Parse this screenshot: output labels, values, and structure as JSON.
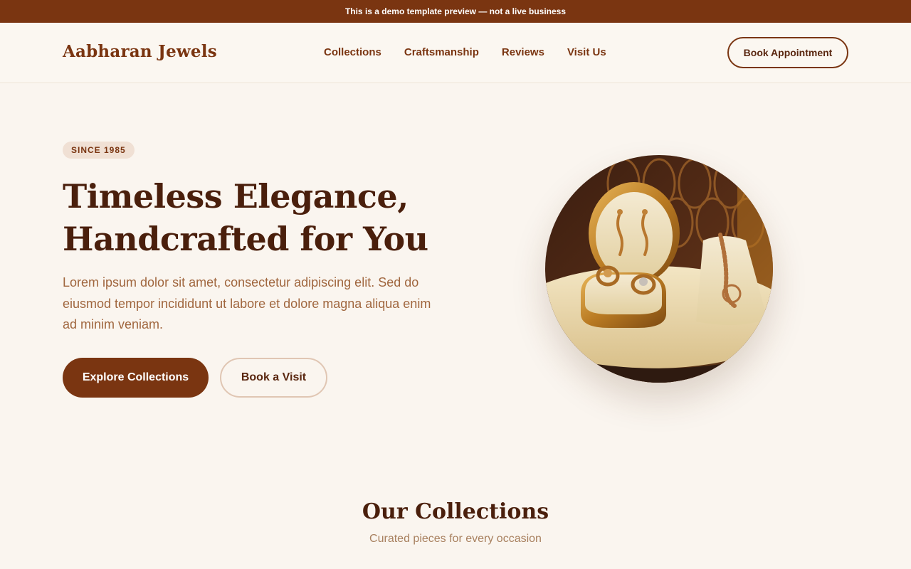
{
  "banner": {
    "text": "This is a demo template preview — not a live business"
  },
  "header": {
    "brand": "Aabharan Jewels",
    "nav": [
      "Collections",
      "Craftsmanship",
      "Reviews",
      "Visit Us"
    ],
    "cta": "Book Appointment"
  },
  "hero": {
    "badge": "SINCE 1985",
    "title_line1": "Timeless Elegance,",
    "title_line2": "Handcrafted for You",
    "description": "Lorem ipsum dolor sit amet, consectetur adipiscing elit. Sed do eiusmod tempor incididunt ut labore et dolore magna aliqua enim ad minim veniam.",
    "primary_button": "Explore Collections",
    "secondary_button": "Book a Visit",
    "image_subject": "jewelry-display-photo"
  },
  "collections": {
    "title": "Our Collections",
    "subtitle": "Curated pieces for every occasion"
  },
  "colors": {
    "brand": "#7a3511",
    "background": "#faf5ef",
    "heading": "#4a1f0c",
    "body_text": "#a0663e",
    "badge_bg": "#f0e0d4"
  }
}
